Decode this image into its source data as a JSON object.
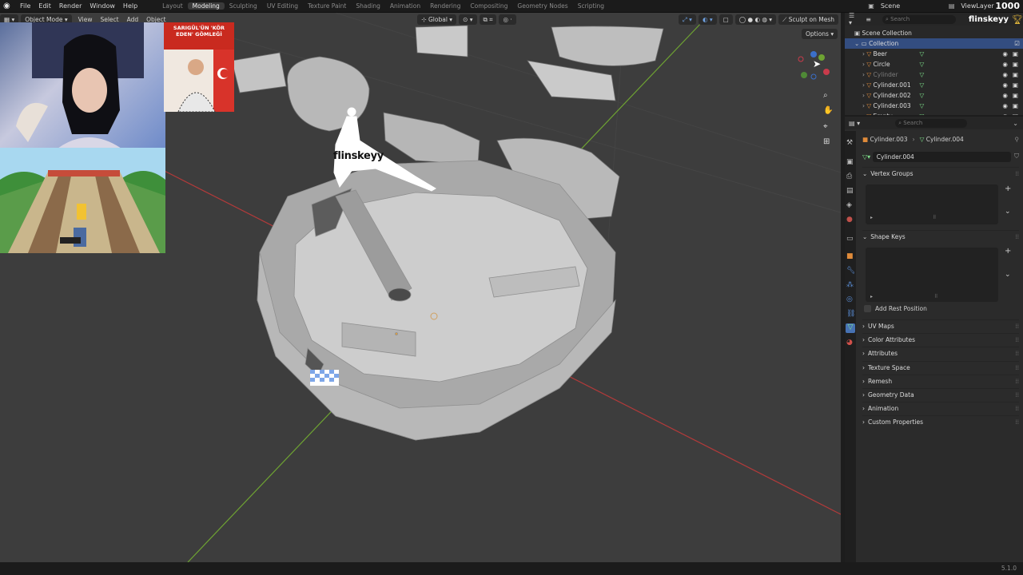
{
  "menus": [
    "File",
    "Edit",
    "Render",
    "Window",
    "Help"
  ],
  "workspaces": [
    "Layout",
    "Modeling",
    "Sculpting",
    "UV Editing",
    "Texture Paint",
    "Shading",
    "Animation",
    "Rendering",
    "Compositing",
    "Geometry Nodes",
    "Scripting"
  ],
  "active_workspace": "Modeling",
  "scene": "Scene",
  "view_layer": "ViewLayer",
  "viewport": {
    "mode": "Object Mode",
    "menus": [
      "View",
      "Select",
      "Add",
      "Object"
    ],
    "orientation": "Global",
    "sculpt_label": "Sculpt on Mesh",
    "options_label": "Options"
  },
  "overlay": {
    "watermark": "flinskeyy",
    "counter": "1000",
    "news_card": "SARIGÜL'ÜN 'KÖR EDEN' GÖMLEĞİ"
  },
  "outliner": {
    "search_placeholder": "Search",
    "root": "Scene Collection",
    "collection": "Collection",
    "items": [
      "Beer",
      "Circle",
      "Cylinder",
      "Cylinder.001",
      "Cylinder.002",
      "Cylinder.003",
      "Empty"
    ]
  },
  "properties": {
    "search_placeholder": "Search",
    "breadcrumb_object": "Cylinder.003",
    "breadcrumb_data": "Cylinder.004",
    "datablock": "Cylinder.004",
    "panels": {
      "vertex_groups": "Vertex Groups",
      "shape_keys": "Shape Keys",
      "add_rest_position": "Add Rest Position",
      "collapsed": [
        "UV Maps",
        "Color Attributes",
        "Attributes",
        "Texture Space",
        "Remesh",
        "Geometry Data",
        "Animation",
        "Custom Properties"
      ]
    }
  },
  "status": {
    "version": "5.1.0"
  },
  "colors": {
    "accent": "#4772b3",
    "viewport_bg": "#3d3d3d",
    "x_axis": "#b23a3a",
    "y_axis": "#6ea332",
    "mesh_icon": "#5fbf6a",
    "object_icon": "#e08b3a"
  }
}
